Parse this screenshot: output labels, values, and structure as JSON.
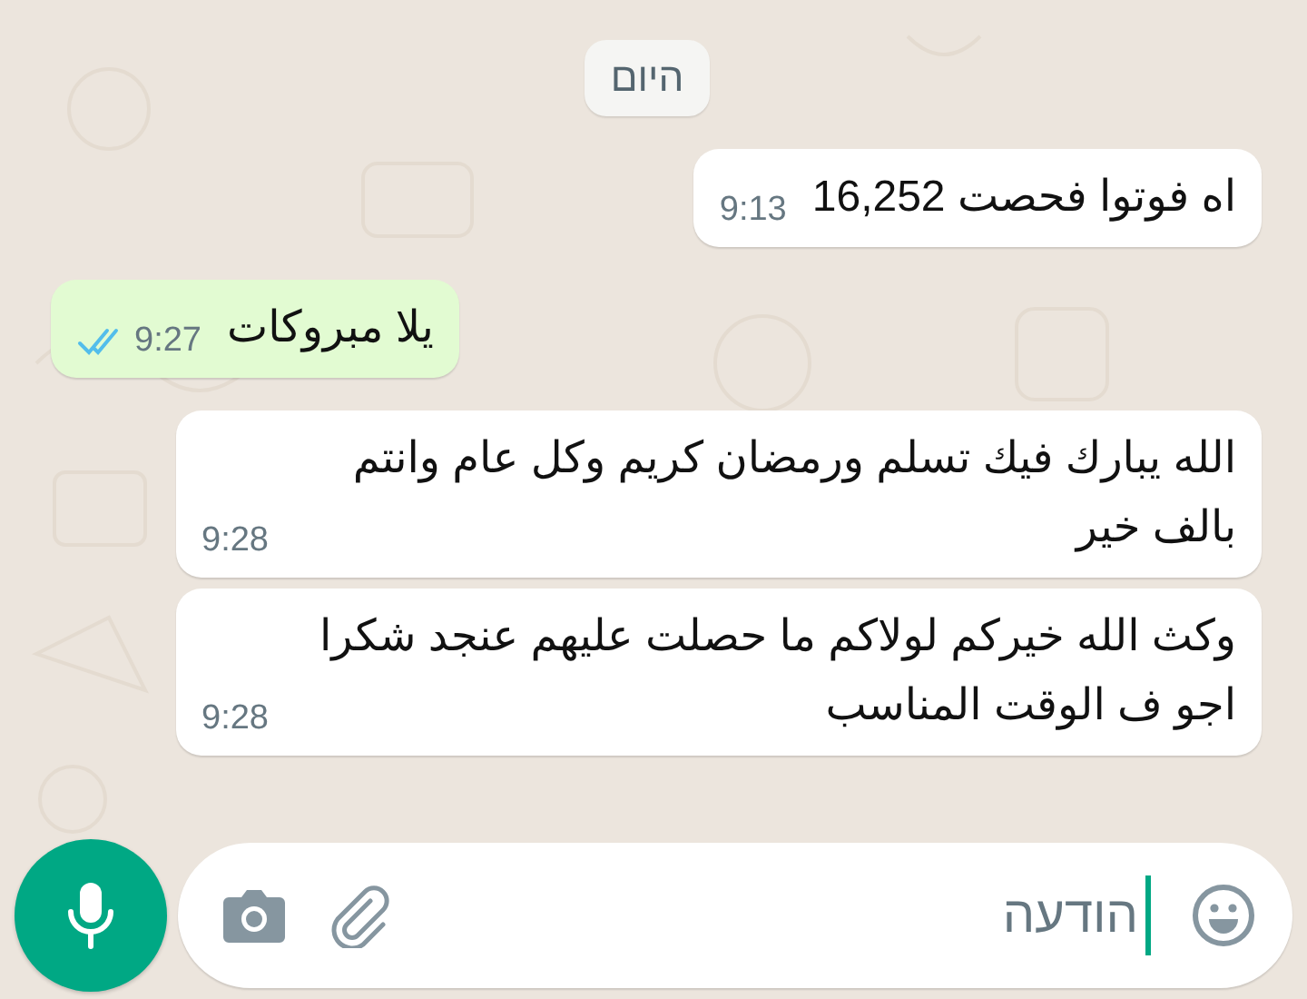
{
  "date_chip": "היום",
  "messages": [
    {
      "kind": "in",
      "text": "اه فوتوا فحصت 16,252",
      "time": "9:13"
    },
    {
      "kind": "out",
      "text": "يلا مبروكات",
      "time": "9:27",
      "read": true
    },
    {
      "kind": "in",
      "text": "الله يبارك فيك تسلم ورمضان كريم وكل عام وانتم بالف خير",
      "time": "9:28"
    },
    {
      "kind": "in",
      "text": "وكث الله خيركم لولاكم ما حصلت عليهم عنجد شكرا اجو ف الوقت المناسب",
      "time": "9:28"
    }
  ],
  "composer": {
    "placeholder": "הודעה"
  }
}
